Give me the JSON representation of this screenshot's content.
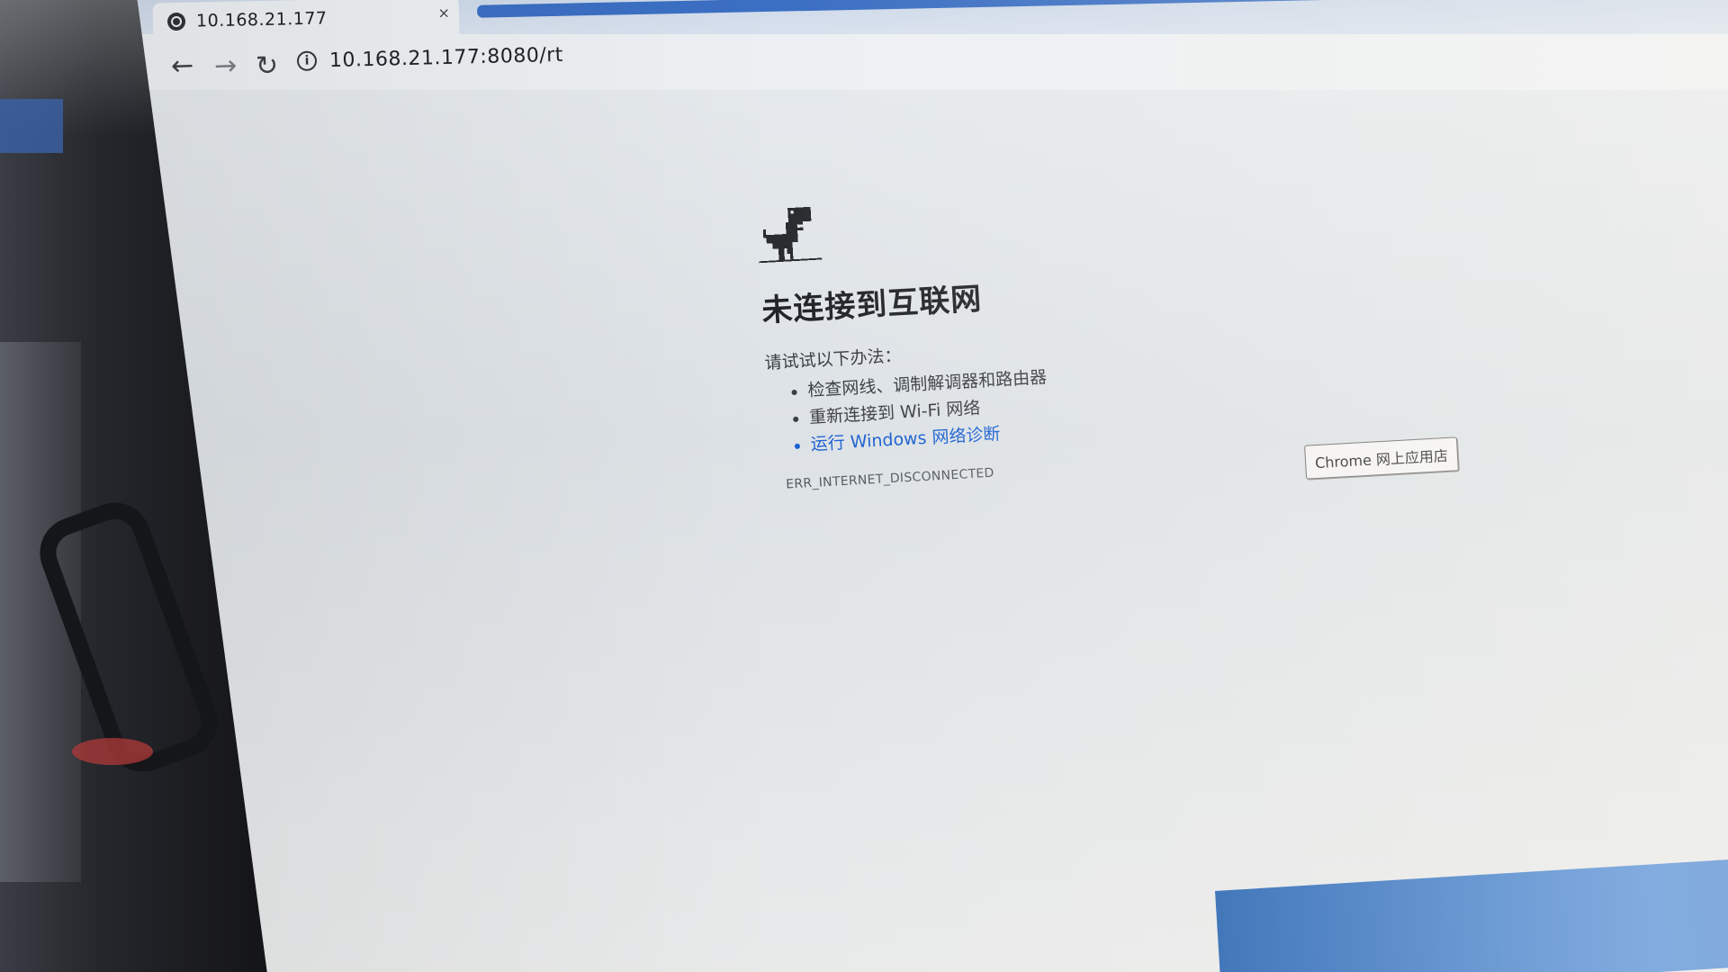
{
  "browser": {
    "tab_title": "10.168.21.177",
    "tab_close": "×",
    "url": "10.168.21.177:8080/rt",
    "info_icon": "i"
  },
  "icons": {
    "back": "←",
    "forward": "→",
    "reload": "↻"
  },
  "error_page": {
    "heading": "未连接到互联网",
    "intro": "请试试以下办法：",
    "tips": [
      "检查网线、调制解调器和路由器",
      "重新连接到 Wi-Fi 网络",
      "运行 Windows 网络诊断"
    ],
    "error_code": "ERR_INTERNET_DISCONNECTED"
  },
  "store_button": "Chrome 网上应用店",
  "colors": {
    "link": "#1a5fd1",
    "tab_accent": "#3b6fc3",
    "taskbar": "#2b6cc0"
  }
}
